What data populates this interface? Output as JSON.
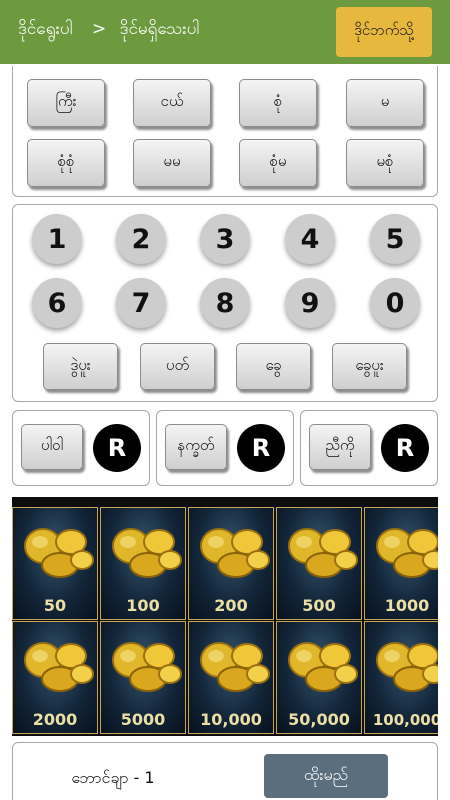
{
  "header": {
    "breadcrumb_1": "ဒိုင်ရွေးပါ",
    "separator": ">",
    "breadcrumb_2": "ဒိုင်မရှိသေးပါ",
    "button": "ဒိုင်ဘက်သို့"
  },
  "type_buttons": [
    "ကြီး",
    "ငယ်",
    "စုံ",
    "မ",
    "စုံစုံ",
    "မမ",
    "စုံမ",
    "မစုံ"
  ],
  "digits": [
    "1",
    "2",
    "3",
    "4",
    "5",
    "6",
    "7",
    "8",
    "9",
    "0"
  ],
  "extra_buttons": [
    "ဒွဲပူး",
    "ပတ်",
    "ခွေ",
    "ခွေပူး"
  ],
  "special": [
    {
      "label": "ပါဝါ",
      "badge": "R"
    },
    {
      "label": "နက္ခတ်",
      "badge": "R"
    },
    {
      "label": "ညီကို",
      "badge": "R"
    }
  ],
  "amounts": [
    "50",
    "100",
    "200",
    "500",
    "1000",
    "2000",
    "5000",
    "10,000",
    "50,000",
    "100,000"
  ],
  "footer": {
    "count_label": "ဘောင်ချာ - 1",
    "submit": "ထိုးမည်"
  },
  "colors": {
    "header_bg": "#6e9a3f",
    "header_button": "#e7b83e",
    "submit_bg": "#5b6e7d",
    "coin_border": "#c7a658"
  }
}
